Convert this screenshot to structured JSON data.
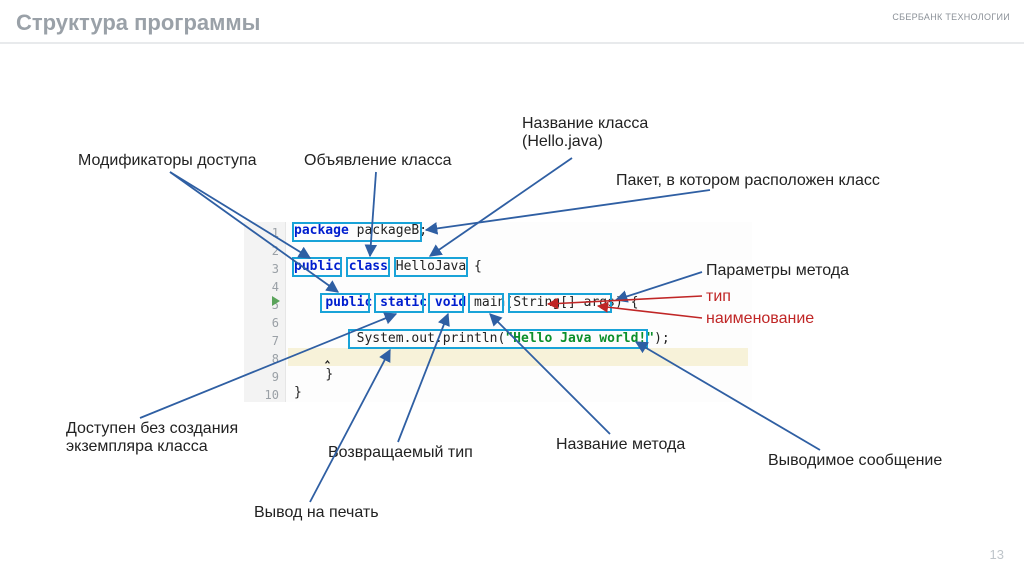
{
  "header": {
    "title": "Структура программы",
    "logo": "СБЕРБАНК ТЕХНОЛОГИИ",
    "page": "13"
  },
  "code": {
    "lines": [
      "1",
      "2",
      "3",
      "4",
      "5",
      "6",
      "7",
      "8",
      "9",
      "10"
    ],
    "tokens": {
      "pkg_kw": "package",
      "pkg_name": "packageB",
      "semi": ";",
      "public": "public",
      "class_kw": "class",
      "class_name": "HelloJava",
      "obrace": "{",
      "static_kw": "static",
      "void_kw": "void",
      "method_name": "main",
      "param_type": "String[]",
      "param_name": "args",
      "oparen": "(",
      "cparen": ")",
      "call": "System.out.println(",
      "msg": "\"Hello Java world!\"",
      "call_end": ");",
      "cbrace": "}"
    }
  },
  "labels": {
    "access_mod": "Модификаторы доступа",
    "class_decl": "Объявление класса",
    "class_name": "Название класса\n(Hello.java)",
    "package": "Пакет, в котором расположен класс",
    "params": "Параметры метода",
    "param_type": "тип",
    "param_name": "наименование",
    "static": "Доступен без создания\nэкземпляра класса",
    "ret_type": "Возвращаемый тип",
    "method_name": "Название метода",
    "out_msg": "Выводимое сообщение",
    "print": "Вывод на печать"
  }
}
